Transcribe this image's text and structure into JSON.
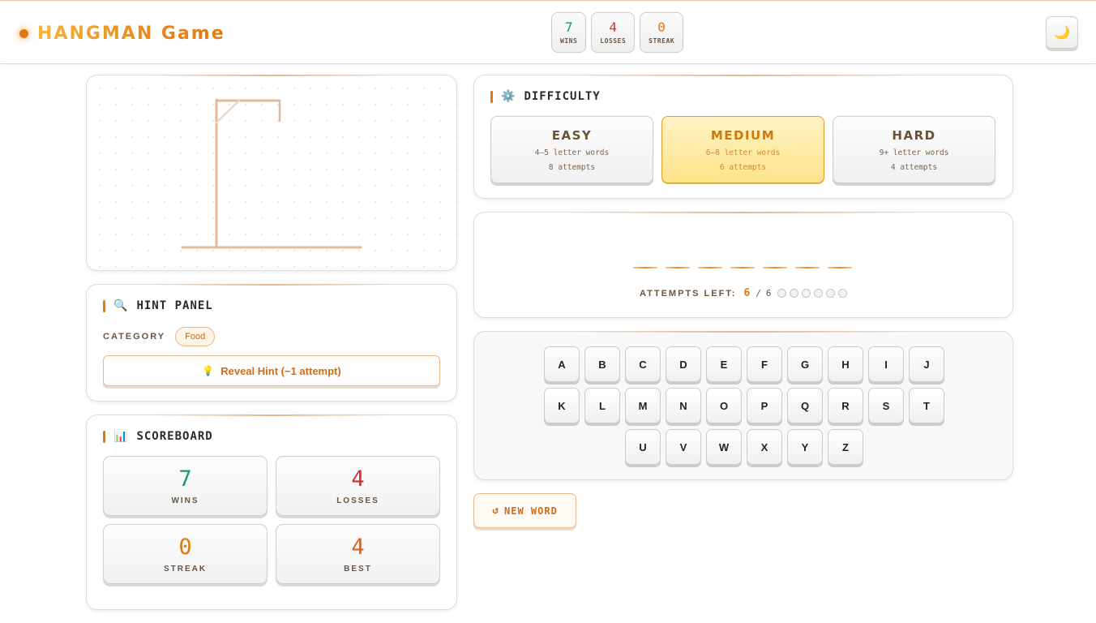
{
  "header": {
    "title": "HANGMAN Game",
    "stats": [
      {
        "label": "WINS",
        "value": "7",
        "color": "#1a9a6a"
      },
      {
        "label": "LOSSES",
        "value": "4",
        "color": "#d03030"
      },
      {
        "label": "STREAK",
        "value": "0",
        "color": "#e07a10"
      }
    ],
    "theme_icon": "moon-icon",
    "theme_glyph": "🌙"
  },
  "hint_panel": {
    "title": "HINT PANEL",
    "icon": "magnifier-icon",
    "icon_glyph": "🔍",
    "category_label": "CATEGORY",
    "category_value": "Food",
    "reveal_button": "Reveal Hint (−1 attempt)",
    "reveal_icon": "lightbulb-icon",
    "reveal_glyph": "💡"
  },
  "scoreboard": {
    "title": "SCOREBOARD",
    "icon": "bar-chart-icon",
    "icon_glyph": "📊",
    "items": [
      {
        "label": "WINS",
        "value": "7",
        "color": "#1a9a6a"
      },
      {
        "label": "LOSSES",
        "value": "4",
        "color": "#d03030"
      },
      {
        "label": "STREAK",
        "value": "0",
        "color": "#e07a10"
      },
      {
        "label": "BEST",
        "value": "4",
        "color": "#e0601a"
      }
    ]
  },
  "difficulty": {
    "title": "DIFFICULTY",
    "icon": "gear-icon",
    "icon_glyph": "⚙️",
    "selected": "MEDIUM",
    "options": [
      {
        "name": "EASY",
        "words": "4–5 letter words",
        "attempts": "8 attempts"
      },
      {
        "name": "MEDIUM",
        "words": "6–8 letter words",
        "attempts": "6 attempts"
      },
      {
        "name": "HARD",
        "words": "9+ letter words",
        "attempts": "4 attempts"
      }
    ]
  },
  "word": {
    "letter_count": 7,
    "attempts_label": "ATTEMPTS LEFT:",
    "attempts_left": "6",
    "separator": "/",
    "attempts_max": "6"
  },
  "keyboard": {
    "rows": [
      [
        "A",
        "B",
        "C",
        "D",
        "E",
        "F",
        "G",
        "H",
        "I",
        "J"
      ],
      [
        "K",
        "L",
        "M",
        "N",
        "O",
        "P",
        "Q",
        "R",
        "S",
        "T"
      ],
      [
        "U",
        "V",
        "W",
        "X",
        "Y",
        "Z"
      ]
    ]
  },
  "new_word_button": "NEW WORD",
  "new_word_icon": "refresh-icon",
  "new_word_glyph": "↺"
}
